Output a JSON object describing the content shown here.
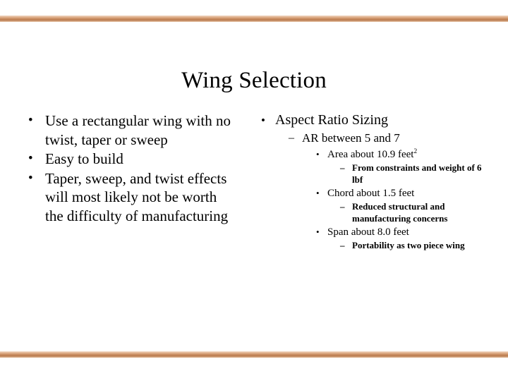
{
  "slide": {
    "title": "Wing Selection",
    "background_color": "#ffffff",
    "text_color": "#000000",
    "rule_color": "#c98b5e",
    "bullet_glyph": "•",
    "dash_glyph": "–"
  },
  "left_column": {
    "items": [
      {
        "level": 1,
        "text": "Use a rectangular wing with no twist, taper or sweep"
      },
      {
        "level": 1,
        "text": "Easy to build"
      },
      {
        "level": 1,
        "text": "Taper, sweep, and twist effects will most likely not be worth the difficulty of manufacturing"
      }
    ]
  },
  "right_column": {
    "items": [
      {
        "level": 1,
        "text": "Aspect Ratio Sizing"
      },
      {
        "level": 2,
        "text": "AR between 5 and 7"
      },
      {
        "level": 3,
        "text_before_sup": "Area about 10.9 feet",
        "sup": "2"
      },
      {
        "level": 4,
        "text": "From constraints and weight of 6 lbf"
      },
      {
        "level": 3,
        "text": "Chord about 1.5 feet"
      },
      {
        "level": 4,
        "text": "Reduced structural and manufacturing concerns"
      },
      {
        "level": 3,
        "text": "Span about 8.0 feet"
      },
      {
        "level": 4,
        "text": "Portability as two piece wing"
      }
    ]
  }
}
